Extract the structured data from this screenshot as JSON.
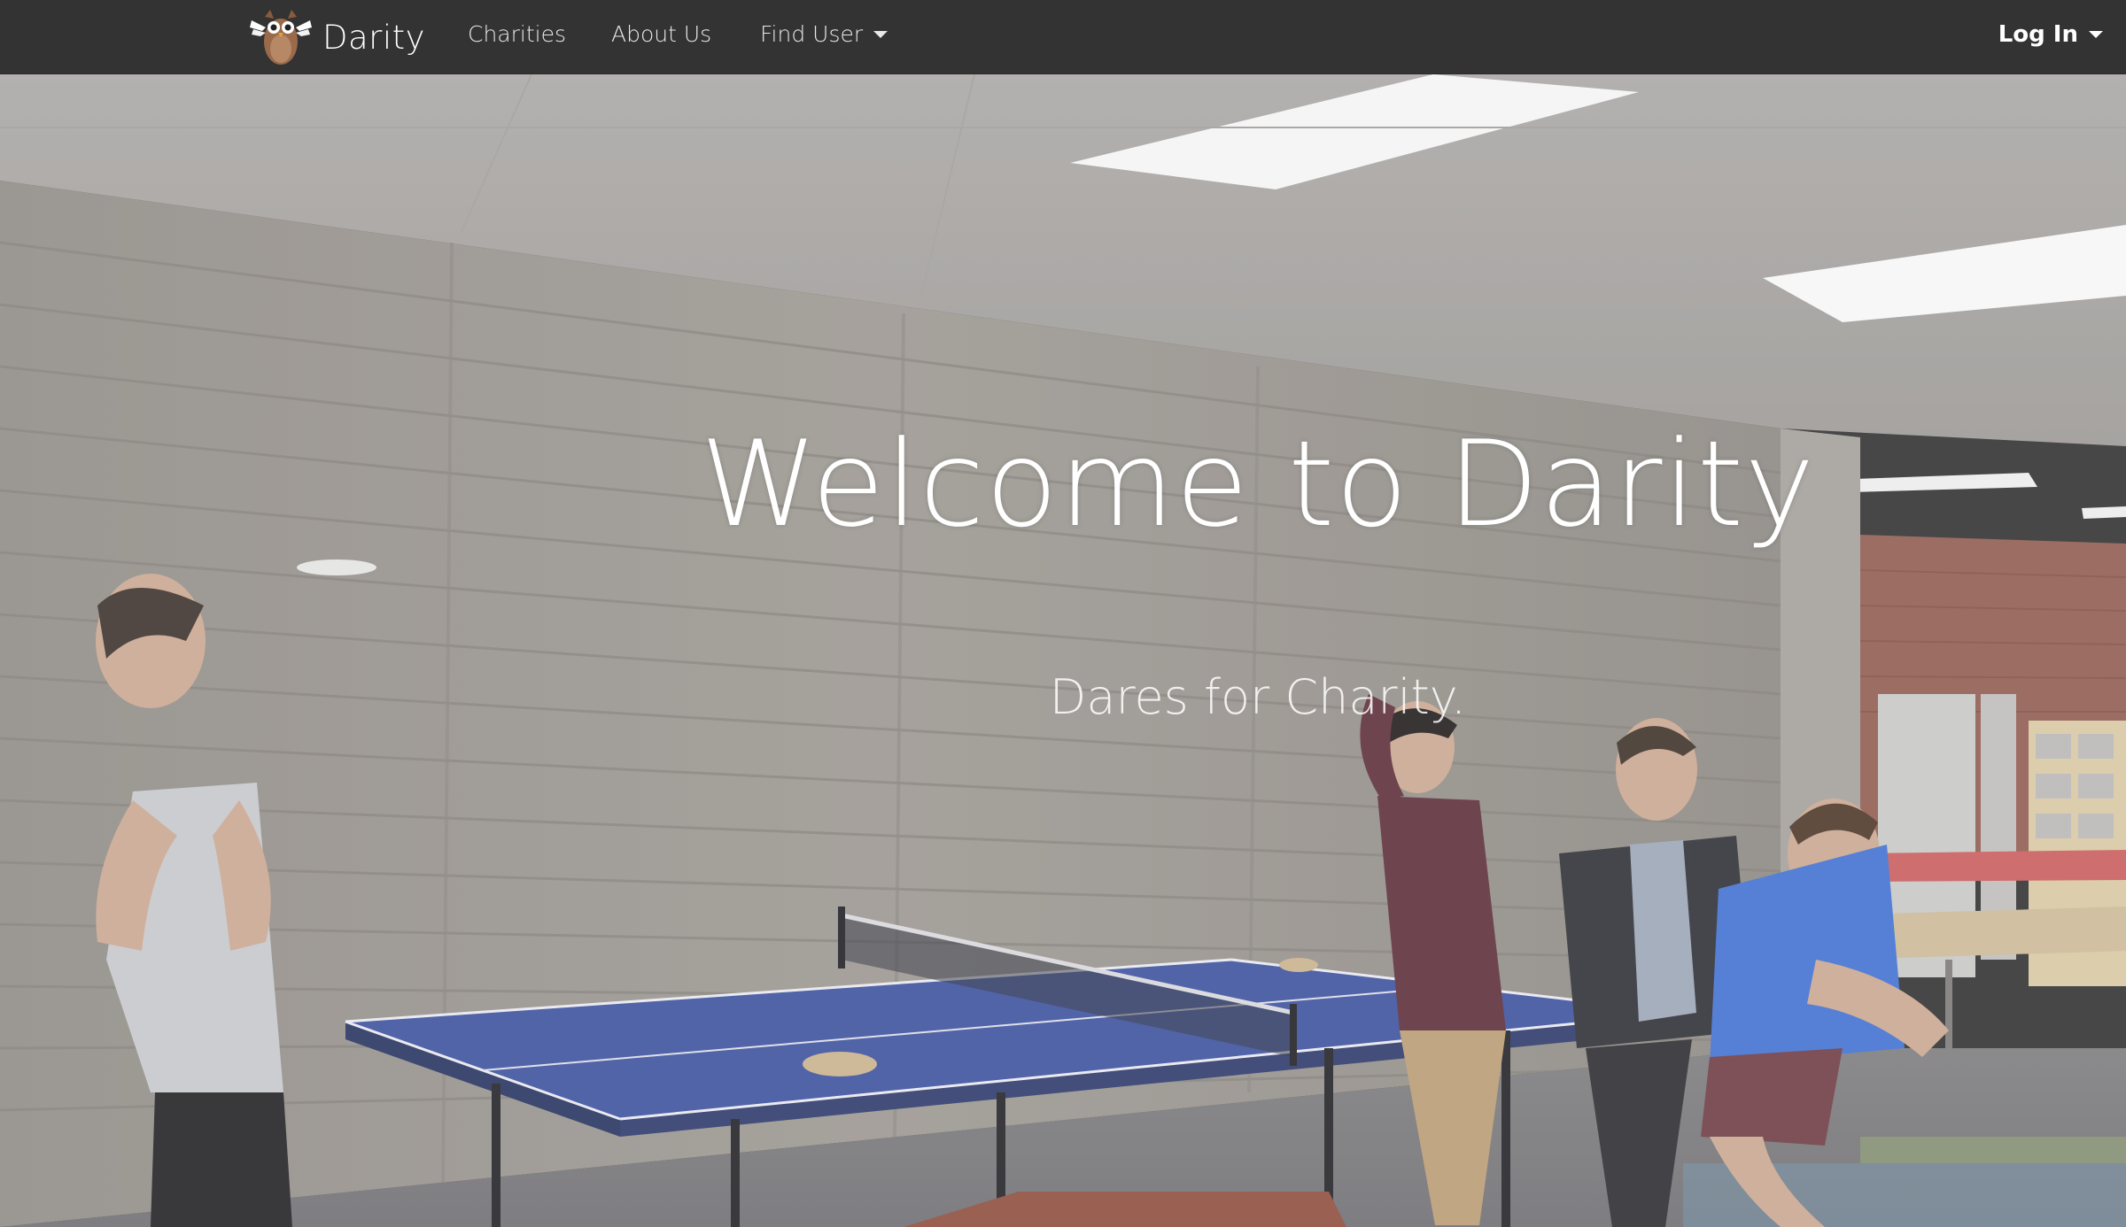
{
  "navbar": {
    "brand": "Darity",
    "links": {
      "charities": "Charities",
      "about": "About Us",
      "find_user": "Find User"
    },
    "login": "Log In"
  },
  "hero": {
    "title": "Welcome to Darity",
    "subtitle": "Dares for Charity."
  },
  "colors": {
    "navbar_bg": "#333333",
    "table_blue": "#3a4f9c",
    "shirt_blue": "#3f6fd0"
  }
}
